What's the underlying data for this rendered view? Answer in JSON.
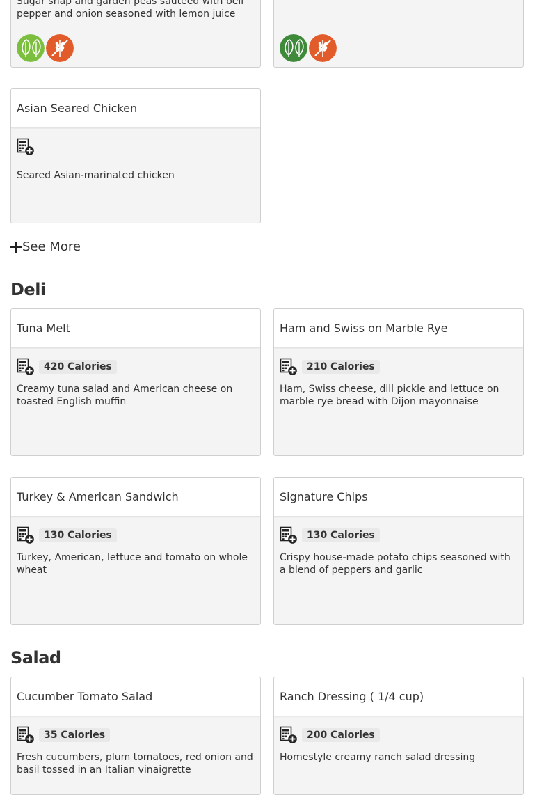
{
  "colors": {
    "vegetarian": "#7cbf3f",
    "vegan": "#3f8a3a",
    "gluten_free": "#e25b2b"
  },
  "top_cards": {
    "left": {
      "description": "Sugar snap and garden peas sauteed with bell pepper and onion seasoned with lemon juice an…",
      "icons": [
        "vegetarian-icon",
        "gluten-free-icon"
      ]
    },
    "right": {
      "icons": [
        "vegan-icon",
        "gluten-free-icon"
      ]
    }
  },
  "entree_cards": [
    {
      "name": "Asian Seared Chicken",
      "calories": "",
      "description": "Seared Asian-marinated chicken"
    }
  ],
  "see_more": {
    "label": "See More"
  },
  "sections": [
    {
      "title": "Deli",
      "items": [
        {
          "name": "Tuna Melt",
          "calories": "420 Calories",
          "description": "Creamy tuna salad and American cheese on toasted English muffin"
        },
        {
          "name": "Ham and Swiss on Marble Rye",
          "calories": "210 Calories",
          "description": "Ham, Swiss cheese, dill pickle and lettuce on marble rye bread with Dijon mayonnaise"
        },
        {
          "name": "Turkey & American Sandwich",
          "calories": "130 Calories",
          "description": "Turkey, American, lettuce and tomato on whole wheat"
        },
        {
          "name": "Signature Chips",
          "calories": "130 Calories",
          "description": "Crispy house-made potato chips seasoned with a blend of peppers and garlic"
        }
      ]
    },
    {
      "title": "Salad",
      "items": [
        {
          "name": "Cucumber Tomato Salad",
          "calories": "35 Calories",
          "description": "Fresh cucumbers, plum tomatoes, red onion and basil tossed in an Italian vinaigrette"
        },
        {
          "name": "Ranch Dressing ( 1/4 cup)",
          "calories": "200 Calories",
          "description": "Homestyle creamy ranch salad dressing"
        }
      ]
    }
  ]
}
